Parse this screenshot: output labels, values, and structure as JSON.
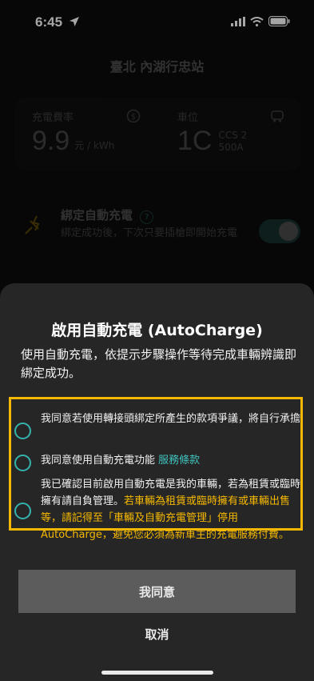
{
  "status_bar": {
    "time": "6:45",
    "icons": [
      "location-arrow-icon",
      "signal-icon",
      "wifi-icon",
      "battery-icon"
    ]
  },
  "background": {
    "station_name": "臺北 內湖行忠站",
    "fee": {
      "label": "充電費率",
      "value": "9.9",
      "unit": "元 / kWh"
    },
    "spot": {
      "label": "車位",
      "value": "1C",
      "connector": "CCS 2",
      "current": "500A"
    },
    "autocharge": {
      "title": "綁定自動充電",
      "help_icon": "?",
      "description": "綁定成功後，下次只要插槍即開始充電",
      "toggle_on": true
    }
  },
  "sheet": {
    "title": "啟用自動充電 (AutoCharge)",
    "description": "使用自動充電，依提示步驟操作等待完成車輛辨識即綁定成功。",
    "items": [
      {
        "text": "我同意若使用轉接頭綁定所產生的款項爭議，將自行承擔"
      },
      {
        "text": "我同意使用自動充電功能",
        "link": "服務條款"
      },
      {
        "text": "我已確認目前啟用自動充電是我的車輛，若為租賃或臨時擁有請自負管理。",
        "warning": "若車輛為租賃或臨時擁有或車輛出售等，請記得至「車輛及自動充電管理」停用AutoCharge，避免您必須為新車主的充電服務付費。"
      }
    ],
    "agree_label": "我同意",
    "cancel_label": "取消"
  },
  "colors": {
    "accent": "#34b3ae",
    "highlight": "#f5b800",
    "sheet_bg": "#262626",
    "button_bg": "#5c5c5c"
  }
}
